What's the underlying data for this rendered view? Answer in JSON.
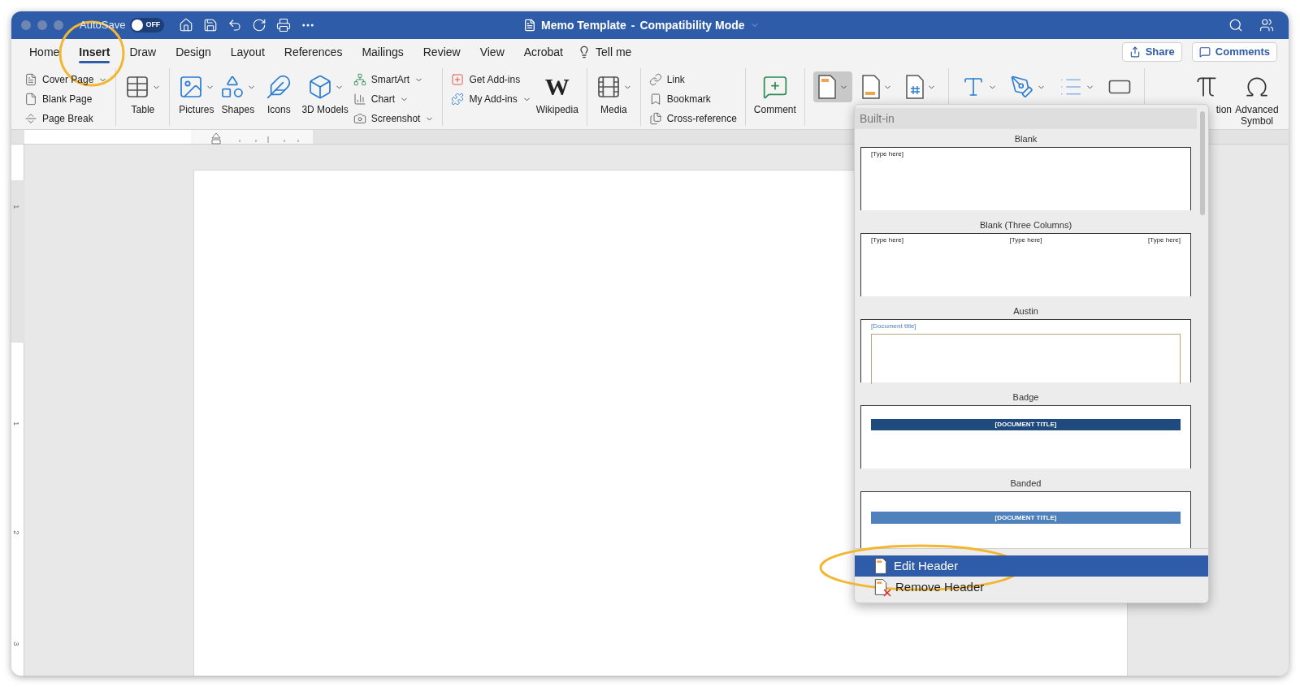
{
  "window": {
    "title": "Memo Template",
    "separator": "-",
    "mode": "Compatibility Mode",
    "autosave": {
      "label": "AutoSave",
      "on": false,
      "state_text": "OFF"
    }
  },
  "menu_tabs": [
    {
      "label": "Home",
      "selected": false
    },
    {
      "label": "Insert",
      "selected": true
    },
    {
      "label": "Draw",
      "selected": false
    },
    {
      "label": "Design",
      "selected": false
    },
    {
      "label": "Layout",
      "selected": false
    },
    {
      "label": "References",
      "selected": false
    },
    {
      "label": "Mailings",
      "selected": false
    },
    {
      "label": "Review",
      "selected": false
    },
    {
      "label": "View",
      "selected": false
    },
    {
      "label": "Acrobat",
      "selected": false
    }
  ],
  "tell_me": "Tell me",
  "share_button": "Share",
  "comments_button": "Comments",
  "ribbon": [
    {
      "items": [
        {
          "kind": "small",
          "label": "Cover Page",
          "menu": true
        },
        {
          "kind": "small",
          "label": "Blank Page",
          "menu": false
        },
        {
          "kind": "small",
          "label": "Page Break",
          "menu": false
        }
      ]
    },
    {
      "items": [
        {
          "kind": "large",
          "label": "Table",
          "menu": true
        }
      ]
    },
    {
      "items": [
        {
          "kind": "large",
          "label": "Pictures",
          "menu": true
        },
        {
          "kind": "large",
          "label": "Shapes",
          "menu": true
        },
        {
          "kind": "large",
          "label": "Icons",
          "menu": false
        },
        {
          "kind": "large",
          "label": "3D Models",
          "menu": true
        },
        {
          "kind": "small",
          "label": "SmartArt",
          "menu": true
        },
        {
          "kind": "small",
          "label": "Chart",
          "menu": true
        },
        {
          "kind": "small",
          "label": "Screenshot",
          "menu": true
        }
      ]
    },
    {
      "items": [
        {
          "kind": "small",
          "label": "Get Add-ins",
          "menu": false
        },
        {
          "kind": "small",
          "label": "My Add-ins",
          "menu": true
        },
        {
          "kind": "large",
          "label": "Wikipedia",
          "menu": false,
          "logo": "W"
        }
      ]
    },
    {
      "items": [
        {
          "kind": "large",
          "label": "Media",
          "menu": true
        }
      ]
    },
    {
      "items": [
        {
          "kind": "small",
          "label": "Link",
          "menu": false
        },
        {
          "kind": "small",
          "label": "Bookmark",
          "menu": false
        },
        {
          "kind": "small",
          "label": "Cross-reference",
          "menu": false
        }
      ]
    },
    {
      "items": [
        {
          "kind": "large",
          "label": "Comment",
          "menu": false
        }
      ]
    },
    {
      "items": [
        {
          "kind": "icon",
          "menu": true,
          "selected": true
        },
        {
          "kind": "icon",
          "menu": true,
          "selected": false
        },
        {
          "kind": "icon",
          "menu": true,
          "selected": false
        }
      ]
    },
    {
      "items": [
        {
          "kind": "icon",
          "menu": true,
          "selected": false
        },
        {
          "kind": "icon",
          "menu": true,
          "selected": false
        },
        {
          "kind": "icon",
          "menu": true,
          "selected": false
        },
        {
          "kind": "icon",
          "menu": false,
          "selected": false
        }
      ]
    },
    {
      "items": [
        {
          "kind": "large",
          "label": "tion",
          "menu": false
        },
        {
          "kind": "large",
          "label": "Advanced Symbol",
          "menu": false
        }
      ]
    }
  ],
  "vertical_ruler": [
    "1",
    "1",
    "2",
    "3"
  ],
  "header_gallery": {
    "section": "Built-in",
    "items": [
      {
        "kind": "blank",
        "name": "Blank",
        "texts": [
          "[Type here]"
        ]
      },
      {
        "kind": "three_columns",
        "name": "Blank (Three Columns)",
        "texts": [
          "[Type here]",
          "[Type here]",
          "[Type here]"
        ]
      },
      {
        "kind": "austin",
        "name": "Austin",
        "texts": [
          "[Document title]"
        ]
      },
      {
        "kind": "badge",
        "name": "Badge",
        "texts": [
          "[DOCUMENT TITLE]"
        ]
      },
      {
        "kind": "banded",
        "name": "Banded",
        "texts": [
          "[DOCUMENT TITLE]"
        ]
      }
    ],
    "actions": [
      {
        "kind": "edit",
        "label": "Edit Header",
        "selected": true
      },
      {
        "kind": "remove",
        "label": "Remove Header",
        "selected": false
      }
    ]
  }
}
